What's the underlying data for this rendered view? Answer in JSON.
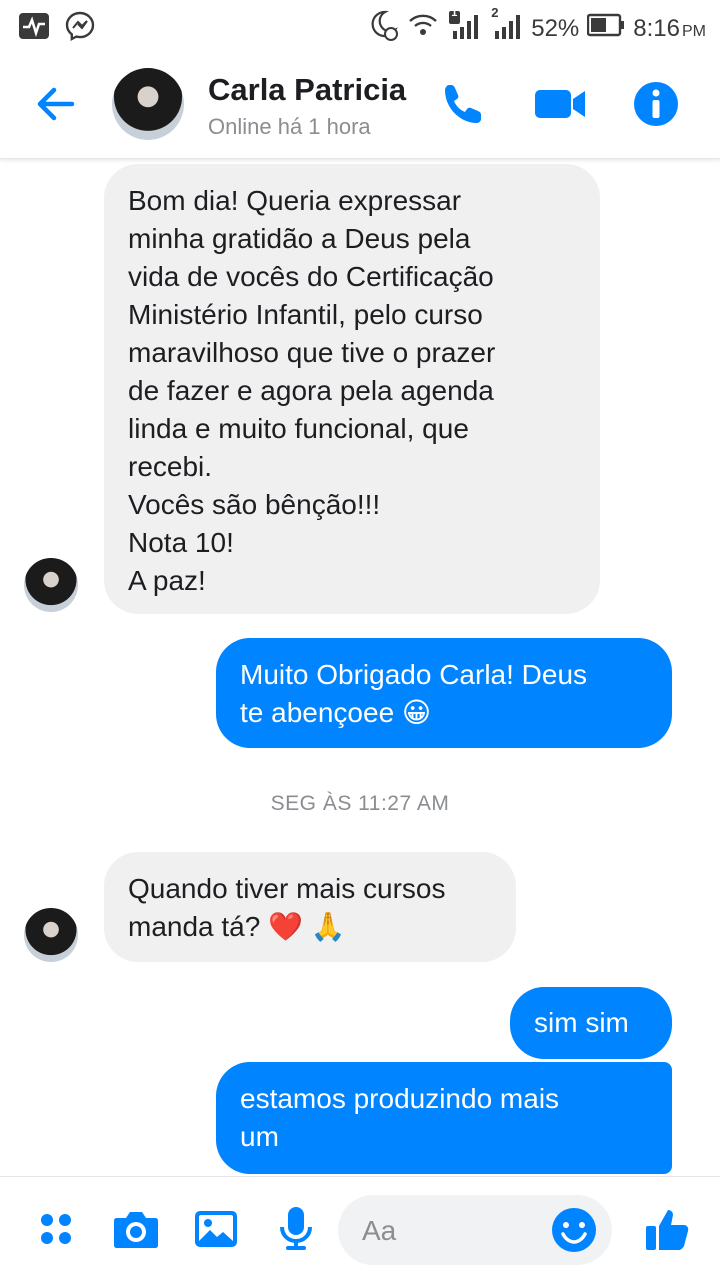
{
  "status_bar": {
    "battery": "52%",
    "time": "8:16",
    "ampm": "PM",
    "sim1": "1",
    "sim2": "2"
  },
  "header": {
    "contact_name": "Carla Patricia",
    "status": "Online há 1 hora"
  },
  "messages": [
    {
      "from": "contact",
      "text": "Bom dia! Queria expressar\nminha gratidão a Deus pela\nvida de vocês do Certificação\nMinistério Infantil, pelo curso\nmaravilhoso que tive o prazer\nde fazer e agora pela agenda\nlinda e muito funcional, que\nrecebi.\nVocês são bênção!!!\nNota 10!\nA paz!"
    },
    {
      "from": "me",
      "text": "Muito Obrigado Carla! Deus\nte abençoee 😀"
    },
    {
      "from": "contact",
      "text": "Quando tiver mais cursos\nmanda tá? ❤️ 🙏"
    },
    {
      "from": "me",
      "text": "sim sim"
    },
    {
      "from": "me",
      "text": "estamos produzindo mais\num"
    }
  ],
  "timestamp": "SEG ÀS 11:27 AM",
  "composer": {
    "placeholder": "Aa"
  },
  "colors": {
    "accent": "#0084ff",
    "incoming_bubble": "#f1f0f0"
  }
}
